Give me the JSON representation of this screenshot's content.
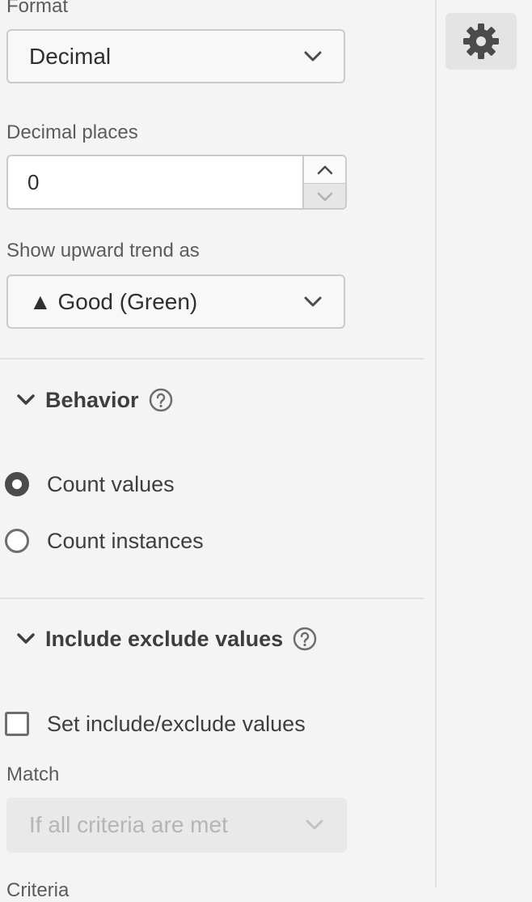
{
  "format": {
    "label": "Format",
    "value": "Decimal"
  },
  "decimal_places": {
    "label": "Decimal places",
    "value": "0"
  },
  "upward_trend": {
    "label": "Show upward trend as",
    "value": "▲ Good (Green)"
  },
  "behavior": {
    "title": "Behavior",
    "options": [
      {
        "label": "Count values",
        "selected": true
      },
      {
        "label": "Count instances",
        "selected": false
      }
    ]
  },
  "include_exclude": {
    "title": "Include exclude values",
    "checkbox_label": "Set include/exclude values",
    "checked": false,
    "match_label": "Match",
    "match_value": "If all criteria are met",
    "criteria_label": "Criteria"
  },
  "icons": {
    "settings": "gear-icon",
    "dropdown": "chevron-down-icon",
    "help": "help-circle-icon",
    "collapse": "chevron-down-icon"
  },
  "colors": {
    "background": "#f4f4f4",
    "text": "#4b4b4b",
    "border": "#cacaca",
    "disabled": "#e9e9e9"
  }
}
